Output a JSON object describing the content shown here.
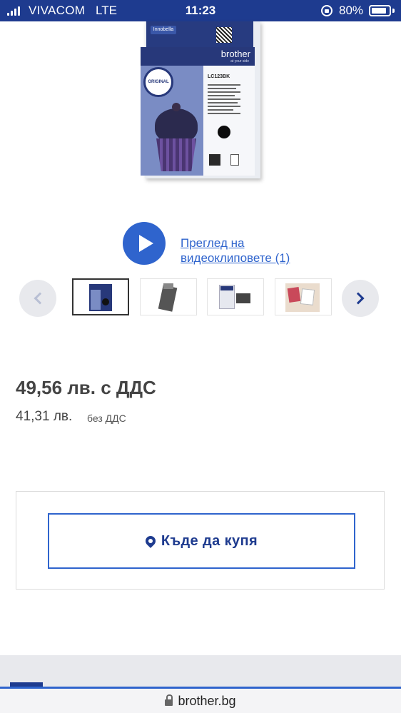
{
  "status_bar": {
    "carrier": "VIVACOM",
    "network": "LTE",
    "time": "11:23",
    "battery": "80%",
    "battery_level": 0.8,
    "icons": [
      "signal-icon",
      "rotation-lock-icon",
      "battery-icon"
    ]
  },
  "product_image": {
    "box_brand": "brother",
    "box_tagline": "at your side",
    "box_model": "LC123BK",
    "box_badge": "ORIGINAL",
    "box_series": "Innobella"
  },
  "video": {
    "link_text": "Преглед на видеоклиповете (1)",
    "icon": "play-icon"
  },
  "thumbnails": {
    "prev_icon": "chevron-left-icon",
    "next_icon": "chevron-right-icon",
    "selected_index": 0,
    "count": 4
  },
  "price": {
    "with_vat": "49,56 лв. с ДДС",
    "without_vat_amount": "41,31 лв.",
    "without_vat_label": "без ДДС"
  },
  "where_to_buy": {
    "label": "Къде да купя",
    "icon": "map-pin-icon"
  },
  "browser": {
    "url": "brother.bg",
    "icon": "lock-icon"
  },
  "colors": {
    "brand_blue": "#1e3b8f",
    "link_blue": "#2f64cd",
    "text_gray": "#444444"
  }
}
